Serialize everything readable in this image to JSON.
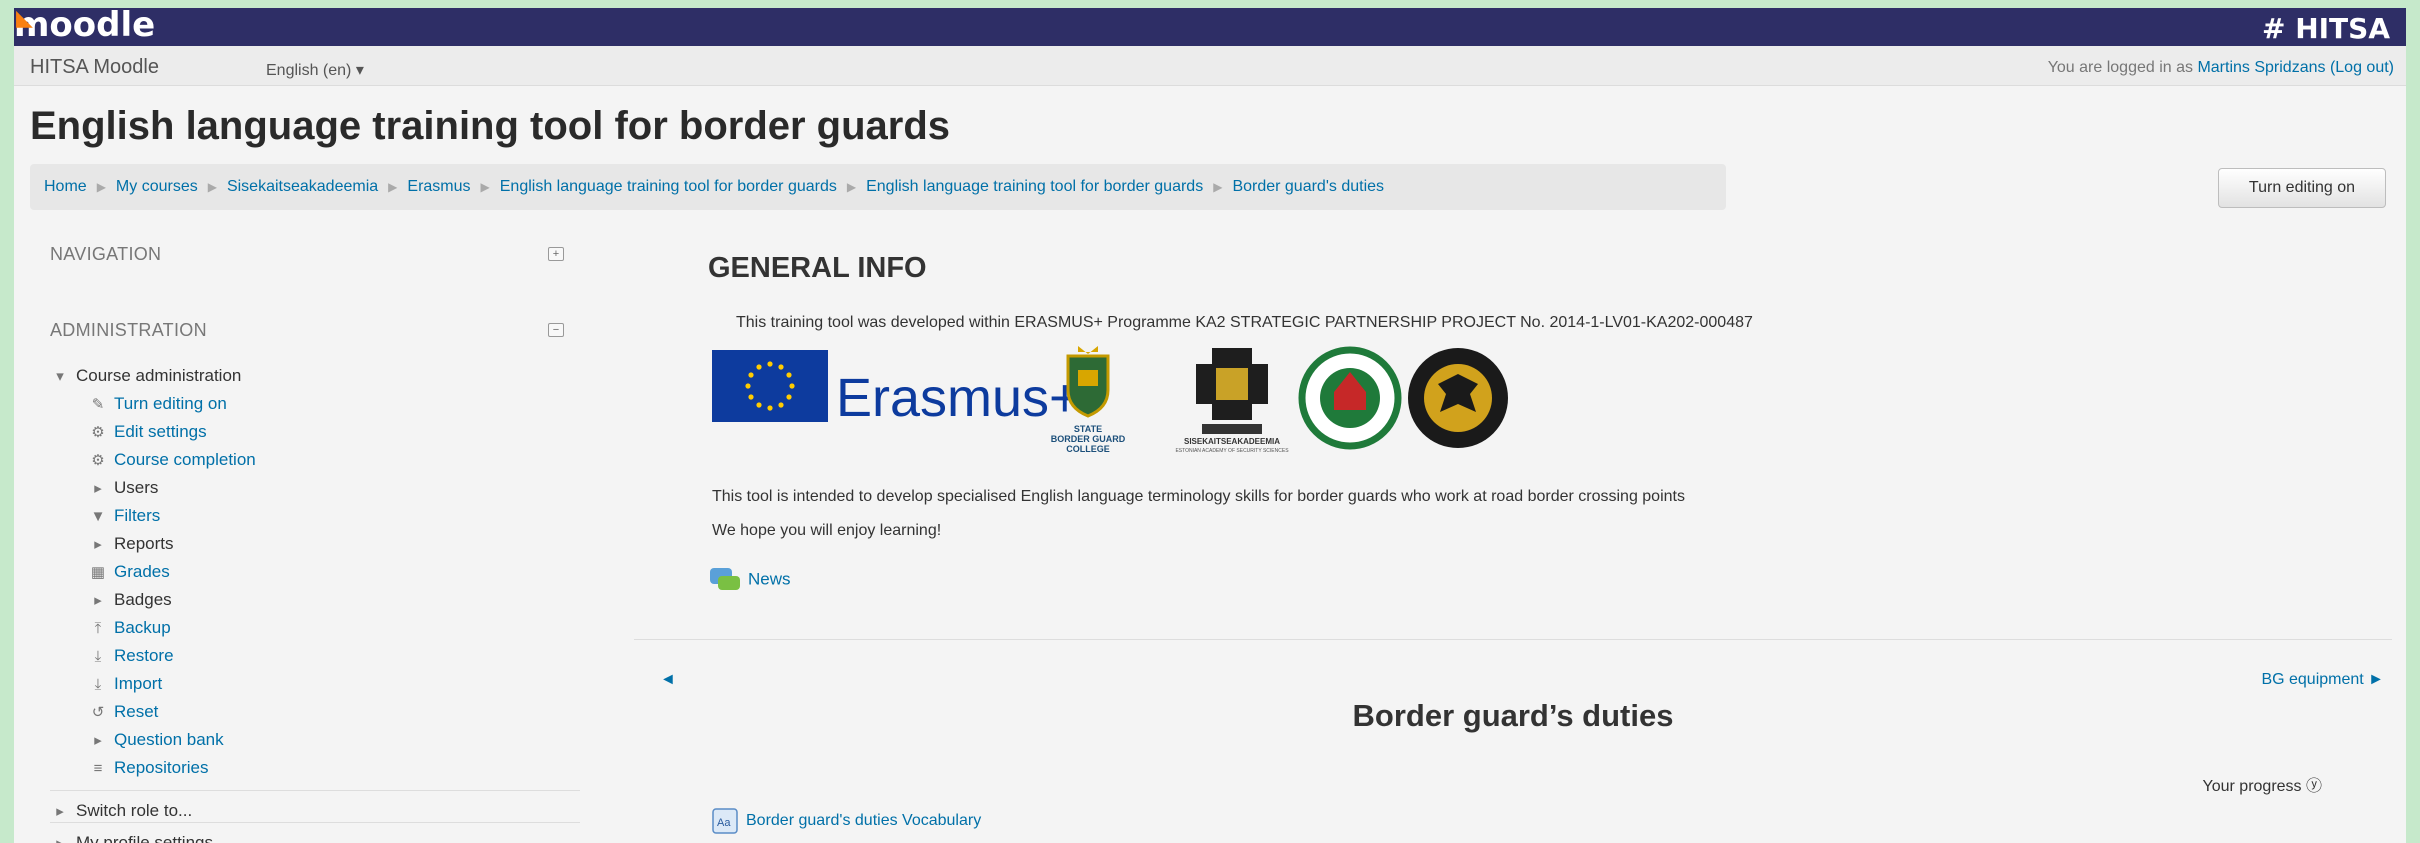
{
  "header": {
    "logo": "moodle",
    "brand": "# HITSA"
  },
  "sitebar": {
    "site_name": "HITSA Moodle",
    "language": "English (en) ▾",
    "login_prefix": "You are logged in as ",
    "user_name": "Martins Spridzans",
    "logout": "(Log out)"
  },
  "course": {
    "title": "English language training tool for border guards"
  },
  "breadcrumb": [
    "Home",
    "My courses",
    "Sisekaitseakadeemia",
    "Erasmus",
    "English language training tool for border guards",
    "English language training tool for border guards",
    "Border guard's duties"
  ],
  "breadcrumb_separator": "▶",
  "turn_editing_button": "Turn editing on",
  "navigation": {
    "heading": "NAVIGATION",
    "toggle_icon": "plus"
  },
  "administration": {
    "heading": "ADMINISTRATION",
    "toggle_icon": "minus",
    "course_admin_label": "Course administration",
    "items": [
      {
        "label": "Turn editing on",
        "icon": "pencil-icon",
        "link": true
      },
      {
        "label": "Edit settings",
        "icon": "gear-icon",
        "link": true
      },
      {
        "label": "Course completion",
        "icon": "gear-icon",
        "link": true
      },
      {
        "label": "Users",
        "icon": "caret-right-icon",
        "link": false
      },
      {
        "label": "Filters",
        "icon": "filter-icon",
        "link": true
      },
      {
        "label": "Reports",
        "icon": "caret-right-icon",
        "link": false
      },
      {
        "label": "Grades",
        "icon": "grid-icon",
        "link": true
      },
      {
        "label": "Badges",
        "icon": "caret-right-icon",
        "link": false
      },
      {
        "label": "Backup",
        "icon": "upload-icon",
        "link": true
      },
      {
        "label": "Restore",
        "icon": "download-icon",
        "link": true
      },
      {
        "label": "Import",
        "icon": "download-icon",
        "link": true
      },
      {
        "label": "Reset",
        "icon": "reset-icon",
        "link": true
      },
      {
        "label": "Question bank",
        "icon": "caret-right-icon",
        "link": true
      },
      {
        "label": "Repositories",
        "icon": "list-icon",
        "link": true
      }
    ],
    "switch_role": "Switch role to...",
    "profile_settings": "My profile settings"
  },
  "main": {
    "section0_title": "GENERAL INFO",
    "intro_text": "This training tool was developed within ERASMUS+ Programme KA2 STRATEGIC PARTNERSHIP PROJECT No. 2014-1-LV01-KA202-000487",
    "logos": {
      "erasmus": "Erasmus+",
      "sbgc_line1": "STATE",
      "sbgc_line2": "BORDER GUARD",
      "sbgc_line3": "COLLEGE",
      "ssa_line1": "SISEKAITSEAKADEEMIA",
      "ssa_line2": "ESTONIAN ACADEMY OF SECURITY SCIENCES"
    },
    "purpose_text": "This tool is intended to develop specialised English language terminology skills for border guards who work at road border crossing points",
    "hope_text": "We hope you will enjoy learning!",
    "news_link": "News",
    "prev_arrow": "◄",
    "next_link": "BG equipment ►",
    "section_title": "Border guard’s duties",
    "progress_label": "Your progress ⓨ",
    "vocab_link": "Border guard's duties Vocabulary"
  },
  "colors": {
    "topbar": "#2e2e66",
    "link": "#0070a8",
    "frame": "#c6e9cb",
    "moodle_orange": "#f98012"
  }
}
